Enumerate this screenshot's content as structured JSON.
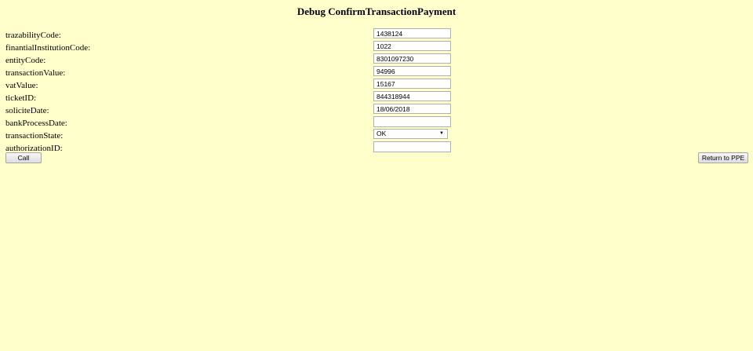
{
  "page": {
    "title": "Debug ConfirmTransactionPayment"
  },
  "form": {
    "fields": [
      {
        "label": "trazabilityCode:",
        "value": "1438124"
      },
      {
        "label": "finantialInstitutionCode:",
        "value": "1022"
      },
      {
        "label": "entityCode:",
        "value": "8301097230"
      },
      {
        "label": "transactionValue:",
        "value": "94996"
      },
      {
        "label": "vatValue:",
        "value": "15167"
      },
      {
        "label": "ticketID:",
        "value": "844318944"
      },
      {
        "label": "soliciteDate:",
        "value": "18/06/2018"
      },
      {
        "label": "bankProcessDate:",
        "value": ""
      },
      {
        "label": "transactionState:",
        "value": "OK"
      },
      {
        "label": "authorizationID:",
        "value": ""
      }
    ]
  },
  "actions": {
    "call_label": "Call",
    "return_label": "Return to PPE"
  },
  "icons": {
    "dropdown": "chevron-down-icon"
  }
}
